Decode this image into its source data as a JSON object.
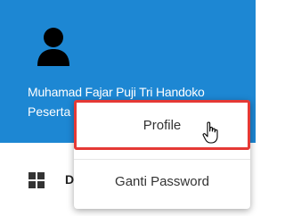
{
  "profile": {
    "name": "Muhamad Fajar Puji Tri Handoko",
    "role": "Peserta",
    "avatar_icon": "user-icon"
  },
  "sidebar": {
    "item_icon": "dashboard-grid-icon",
    "item_label": "D"
  },
  "dropdown": {
    "items": [
      {
        "label": "Profile"
      },
      {
        "label": "Ganti Password"
      }
    ]
  },
  "colors": {
    "header_bg": "#1d87d3",
    "highlight_border": "#e53935"
  }
}
